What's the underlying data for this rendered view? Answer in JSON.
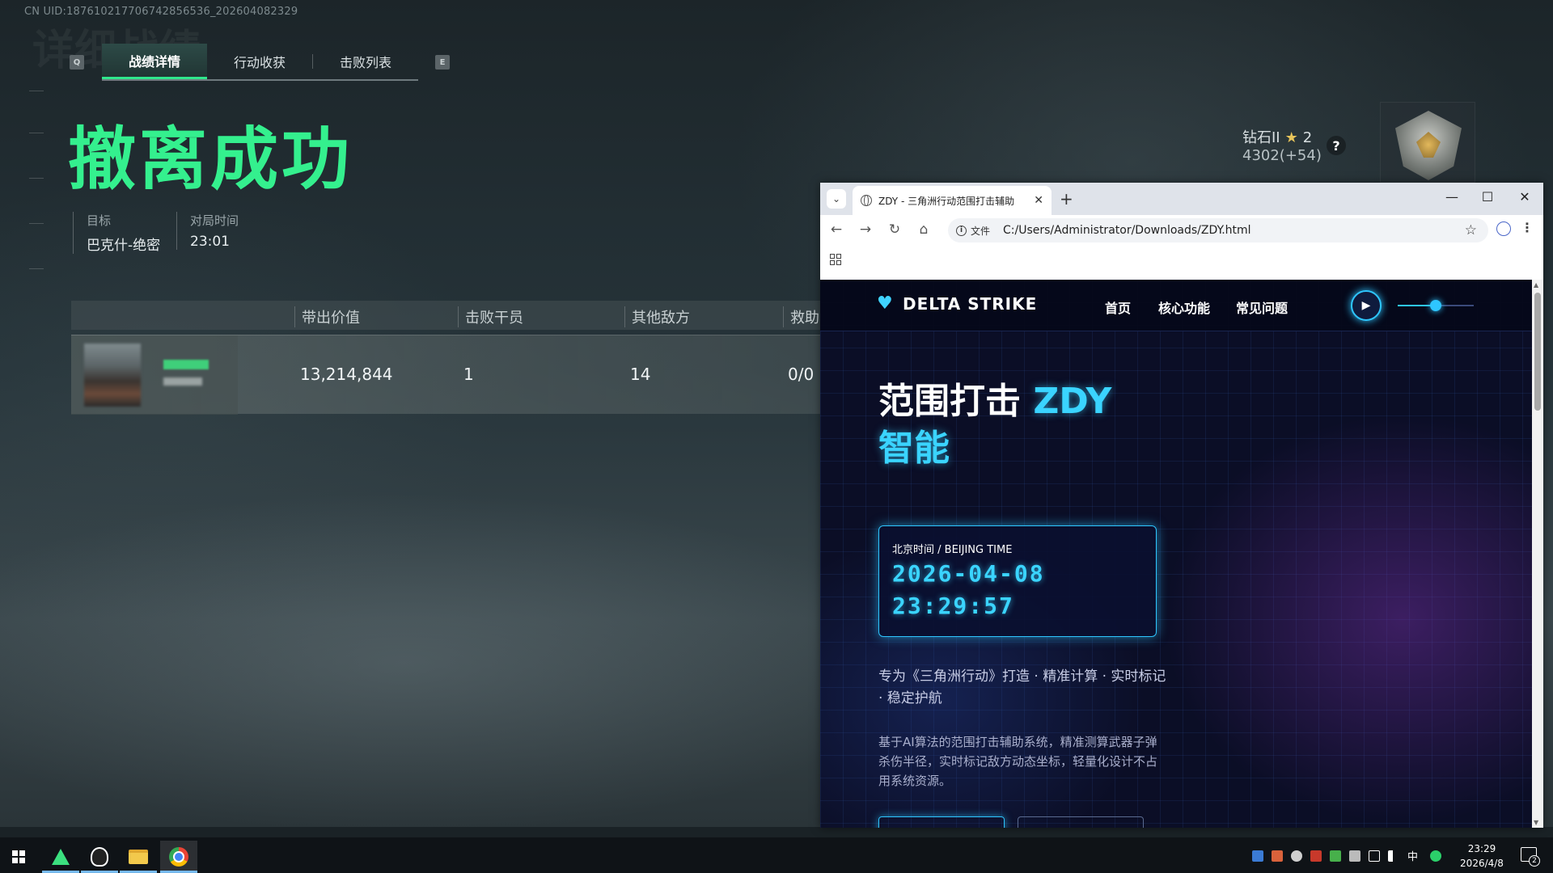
{
  "game": {
    "uid": "CN UID:1876102177067428565​36_202604082329",
    "ghost_title": "详细战绩",
    "key_left": "Q",
    "key_right": "E",
    "tabs": [
      {
        "label": "战绩详情",
        "active": true
      },
      {
        "label": "行动收获",
        "active": false
      },
      {
        "label": "击败列表",
        "active": false
      }
    ],
    "result_title": "撤离成功",
    "info": {
      "target_label": "目标",
      "target_value": "巴克什-绝密",
      "time_label": "对局时间",
      "time_value": "23:01"
    },
    "table": {
      "headers": [
        "带出价值",
        "击败干员",
        "其他敌方",
        "救助"
      ],
      "row": {
        "value": "13,214,844",
        "kills": "1",
        "others": "14",
        "assist": "0/0"
      }
    },
    "rank": {
      "tier": "钻石II",
      "stars": "2",
      "score": "4302(+54)",
      "help": "?"
    }
  },
  "browser": {
    "tab_title": "ZDY - 三角洲行动范围打击辅助",
    "address_chip": "文件",
    "url": "C:/Users/Administrator/Downloads/ZDY.html"
  },
  "site": {
    "logo": "DELTA STRIKE",
    "nav": [
      "首页",
      "核心功能",
      "常见问题"
    ],
    "hero_line1": "范围打击 ",
    "hero_accent1": "ZDY",
    "hero_accent2": "智能",
    "clock_label": "北京时间 / BEIJING TIME",
    "clock_date": "2026-04-08",
    "clock_time": "23:29:57",
    "tagline": "专为《三角洲行动》打造 · 精准计算 · 实时标记 · 稳定护航",
    "description": "基于AI算法的范围打击辅助系统，精准测算武器子弹杀伤半径，实时标记敌方动态坐标，轻量化设计不占用系统资源。",
    "volume": 0.5
  },
  "taskbar": {
    "ime": "中",
    "time": "23:29",
    "date": "2026/4/8",
    "notifications": "2"
  },
  "colors": {
    "game_accent": "#34f08e",
    "site_accent": "#3ad4ff",
    "site_bg": "#0b0e26"
  }
}
